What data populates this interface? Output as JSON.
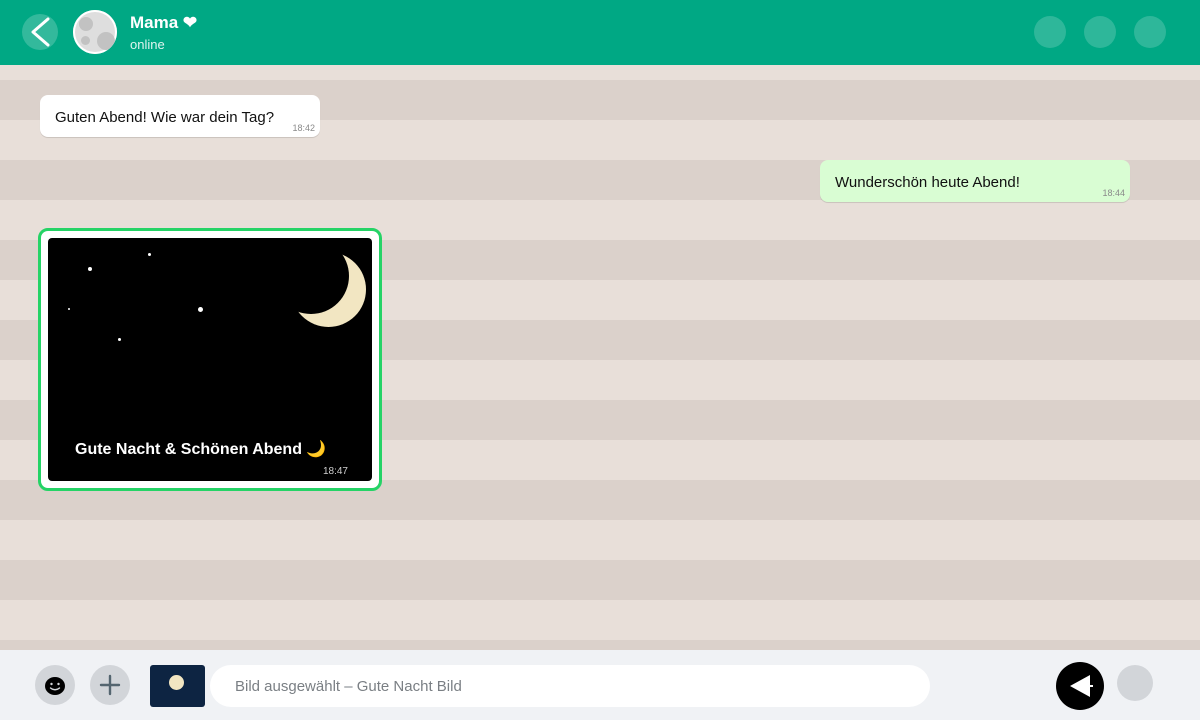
{
  "header": {
    "contact_name": "Mama ❤",
    "status": "online"
  },
  "messages": [
    {
      "direction": "incoming",
      "text": "Guten Abend! Wie war dein Tag?",
      "time": "18:42"
    },
    {
      "direction": "outgoing",
      "text": "Wunderschön heute Abend!",
      "time": "18:44"
    },
    {
      "direction": "incoming",
      "type": "image",
      "caption": "Gute Nacht & Schönen Abend 🌙",
      "time": "18:47"
    }
  ],
  "footer": {
    "input_value": "",
    "input_placeholder": "Bild ausgewählt – Gute Nacht Bild"
  },
  "colors": {
    "header": "#00a884",
    "outgoing_bubble": "#d9fdd3",
    "incoming_bubble": "#ffffff",
    "selected_border": "#25d366",
    "chat_background": "#e8dfd9"
  },
  "icons": [
    "back-arrow-icon",
    "emoji-icon",
    "plus-icon",
    "send-icon"
  ]
}
